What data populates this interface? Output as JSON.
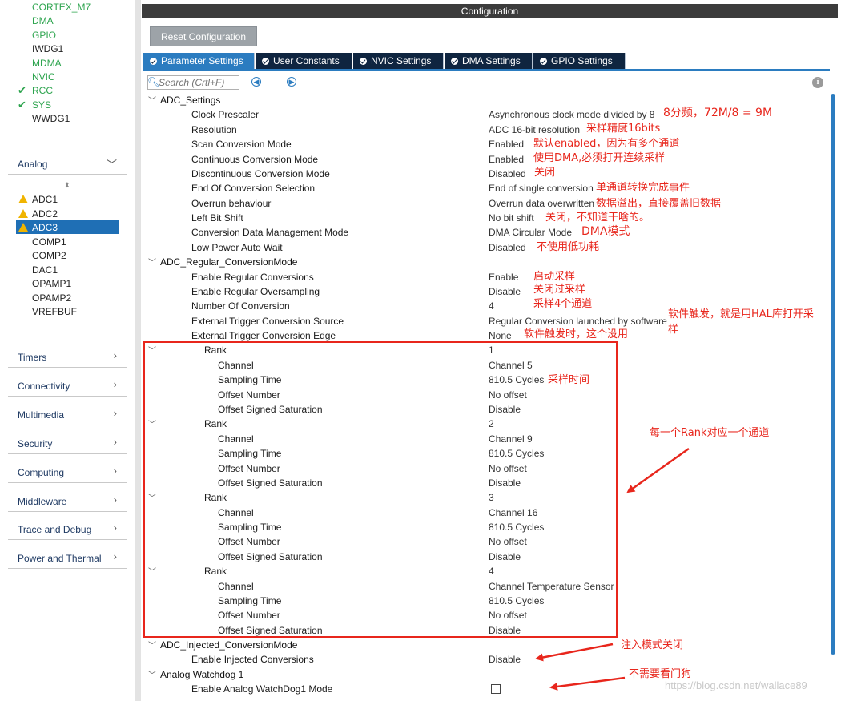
{
  "sidebar": {
    "system_core_items": [
      {
        "label": "CORTEX_M7",
        "state": "green"
      },
      {
        "label": "DMA",
        "state": "green"
      },
      {
        "label": "GPIO",
        "state": "green"
      },
      {
        "label": "IWDG1",
        "state": "black"
      },
      {
        "label": "MDMA",
        "state": "green"
      },
      {
        "label": "NVIC",
        "state": "green"
      },
      {
        "label": "RCC",
        "state": "checked"
      },
      {
        "label": "SYS",
        "state": "checked"
      },
      {
        "label": "WWDG1",
        "state": "black"
      }
    ],
    "analog_category": "Analog",
    "analog_items": [
      {
        "label": "ADC1",
        "state": "warning"
      },
      {
        "label": "ADC2",
        "state": "warning"
      },
      {
        "label": "ADC3",
        "state": "warning-selected"
      },
      {
        "label": "COMP1",
        "state": "black"
      },
      {
        "label": "COMP2",
        "state": "black"
      },
      {
        "label": "DAC1",
        "state": "black"
      },
      {
        "label": "OPAMP1",
        "state": "black"
      },
      {
        "label": "OPAMP2",
        "state": "black"
      },
      {
        "label": "VREFBUF",
        "state": "black"
      }
    ],
    "categories": [
      "Timers",
      "Connectivity",
      "Multimedia",
      "Security",
      "Computing",
      "Middleware",
      "Trace and Debug",
      "Power and Thermal"
    ]
  },
  "config": {
    "header": "Configuration",
    "reset_button": "Reset Configuration",
    "tabs": [
      "Parameter Settings",
      "User Constants",
      "NVIC Settings",
      "DMA Settings",
      "GPIO Settings"
    ],
    "active_tab": "Parameter Settings",
    "search_placeholder": "Search (Crtl+F)"
  },
  "settings": [
    {
      "kind": "section",
      "label": "ADC_Settings"
    },
    {
      "kind": "param",
      "label": "Clock Prescaler",
      "value": "Asynchronous clock mode divided by 8"
    },
    {
      "kind": "param",
      "label": "Resolution",
      "value": "ADC 16-bit resolution"
    },
    {
      "kind": "param",
      "label": "Scan Conversion Mode",
      "value": "Enabled"
    },
    {
      "kind": "param",
      "label": "Continuous Conversion Mode",
      "value": "Enabled"
    },
    {
      "kind": "param",
      "label": "Discontinuous Conversion Mode",
      "value": "Disabled"
    },
    {
      "kind": "param",
      "label": "End Of Conversion Selection",
      "value": "End of single conversion"
    },
    {
      "kind": "param",
      "label": "Overrun behaviour",
      "value": "Overrun data overwritten"
    },
    {
      "kind": "param",
      "label": "Left Bit Shift",
      "value": "No bit shift"
    },
    {
      "kind": "param",
      "label": "Conversion Data Management Mode",
      "value": "DMA Circular Mode"
    },
    {
      "kind": "param",
      "label": "Low Power Auto Wait",
      "value": "Disabled"
    },
    {
      "kind": "section",
      "label": "ADC_Regular_ConversionMode"
    },
    {
      "kind": "param",
      "label": "Enable Regular Conversions",
      "value": "Enable"
    },
    {
      "kind": "param",
      "label": "Enable Regular Oversampling",
      "value": "Disable"
    },
    {
      "kind": "param",
      "label": "Number Of Conversion",
      "value": "4"
    },
    {
      "kind": "param",
      "label": "External Trigger Conversion Source",
      "value": "Regular Conversion launched by software"
    },
    {
      "kind": "param",
      "label": "External Trigger Conversion Edge",
      "value": "None"
    },
    {
      "kind": "rank",
      "label": "Rank",
      "value": "1"
    },
    {
      "kind": "sub",
      "label": "Channel",
      "value": "Channel 5"
    },
    {
      "kind": "sub",
      "label": "Sampling Time",
      "value": "810.5 Cycles"
    },
    {
      "kind": "sub",
      "label": "Offset Number",
      "value": "No offset"
    },
    {
      "kind": "sub",
      "label": "Offset Signed Saturation",
      "value": "Disable"
    },
    {
      "kind": "rank",
      "label": "Rank",
      "value": "2"
    },
    {
      "kind": "sub",
      "label": "Channel",
      "value": "Channel 9"
    },
    {
      "kind": "sub",
      "label": "Sampling Time",
      "value": "810.5 Cycles"
    },
    {
      "kind": "sub",
      "label": "Offset Number",
      "value": "No offset"
    },
    {
      "kind": "sub",
      "label": "Offset Signed Saturation",
      "value": "Disable"
    },
    {
      "kind": "rank",
      "label": "Rank",
      "value": "3"
    },
    {
      "kind": "sub",
      "label": "Channel",
      "value": "Channel 16"
    },
    {
      "kind": "sub",
      "label": "Sampling Time",
      "value": "810.5 Cycles"
    },
    {
      "kind": "sub",
      "label": "Offset Number",
      "value": "No offset"
    },
    {
      "kind": "sub",
      "label": "Offset Signed Saturation",
      "value": "Disable"
    },
    {
      "kind": "rank",
      "label": "Rank",
      "value": "4"
    },
    {
      "kind": "sub",
      "label": "Channel",
      "value": "Channel Temperature Sensor"
    },
    {
      "kind": "sub",
      "label": "Sampling Time",
      "value": "810.5 Cycles"
    },
    {
      "kind": "sub",
      "label": "Offset Number",
      "value": "No offset"
    },
    {
      "kind": "sub",
      "label": "Offset Signed Saturation",
      "value": "Disable"
    },
    {
      "kind": "section",
      "label": "ADC_Injected_ConversionMode"
    },
    {
      "kind": "param",
      "label": "Enable Injected Conversions",
      "value": "Disable"
    },
    {
      "kind": "section",
      "label": "Analog Watchdog 1"
    },
    {
      "kind": "param",
      "label": "Enable Analog WatchDog1 Mode",
      "value": "",
      "checkbox": true
    }
  ],
  "annotations": {
    "clock": "8分频，72M/8 = 9M",
    "resolution": "采样精度16bits",
    "scan": "默认enabled，因为有多个通道",
    "continuous": "使用DMA,必须打开连续采样",
    "discontinuous": "关闭",
    "eoc": "单通道转换完成事件",
    "overrun": "数据溢出，直接覆盖旧数据",
    "left_shift": "关闭，不知道干啥的。",
    "dma_mode": "DMA模式",
    "low_power": "不使用低功耗",
    "enable_regular": "启动采样",
    "oversampling": "关闭过采样",
    "num_conv": "采样4个通道",
    "trigger_source_1": "软件触发，就是用HAL库打开采",
    "trigger_source_2": "样",
    "trigger_edge": "软件触发时，这个没用",
    "sampling_time": "采样时间",
    "rank_note": "每一个Rank对应一个通道",
    "injected": "注入模式关闭",
    "watchdog": "不需要看门狗"
  },
  "watermark": "https://blog.csdn.net/wallace89",
  "colors": {
    "accent_blue": "#2b7cc0",
    "tab_dark": "#0f2540",
    "annotation_red": "#e8261c",
    "enabled_green": "#2da44e",
    "warning_yellow": "#f0b400"
  }
}
